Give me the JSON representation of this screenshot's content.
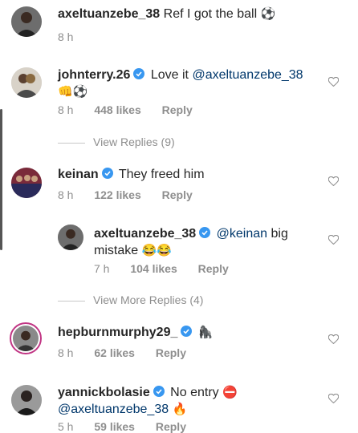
{
  "comments": [
    {
      "username": "axeltuanzebe_38",
      "text": "Ref I got the ball",
      "emoji": "⚽",
      "time": "8 h"
    },
    {
      "username": "johnterry.26",
      "verified": true,
      "text": "Love it",
      "mention": "@axeltuanzebe_38",
      "emoji": "👊⚽",
      "time": "8 h",
      "likes": "448 likes",
      "reply": "Reply",
      "view_replies": "View Replies (9)"
    },
    {
      "username": "keinan",
      "verified": true,
      "text": "They freed him",
      "time": "8 h",
      "likes": "122 likes",
      "reply": "Reply"
    },
    {
      "username": "axeltuanzebe_38",
      "verified": true,
      "mention": "@keinan",
      "text_line1": "big",
      "text_line2": "mistake",
      "emoji": "😂😂",
      "time": "7 h",
      "likes": "104 likes",
      "reply": "Reply",
      "view_more": "View More Replies (4)"
    },
    {
      "username": "hepburnmurphy29_",
      "verified": true,
      "emoji": "🦍",
      "time": "8 h",
      "likes": "62 likes",
      "reply": "Reply"
    },
    {
      "username": "yannickbolasie",
      "verified": true,
      "text": "No entry",
      "emoji1": "⛔",
      "mention": "@axeltuanzebe_38",
      "emoji2": "🔥",
      "time": "5 h",
      "likes": "59 likes",
      "reply": "Reply"
    }
  ],
  "colors": {
    "verified": "#3897f0",
    "meta": "#8e8e8e",
    "mention": "#00376b"
  }
}
